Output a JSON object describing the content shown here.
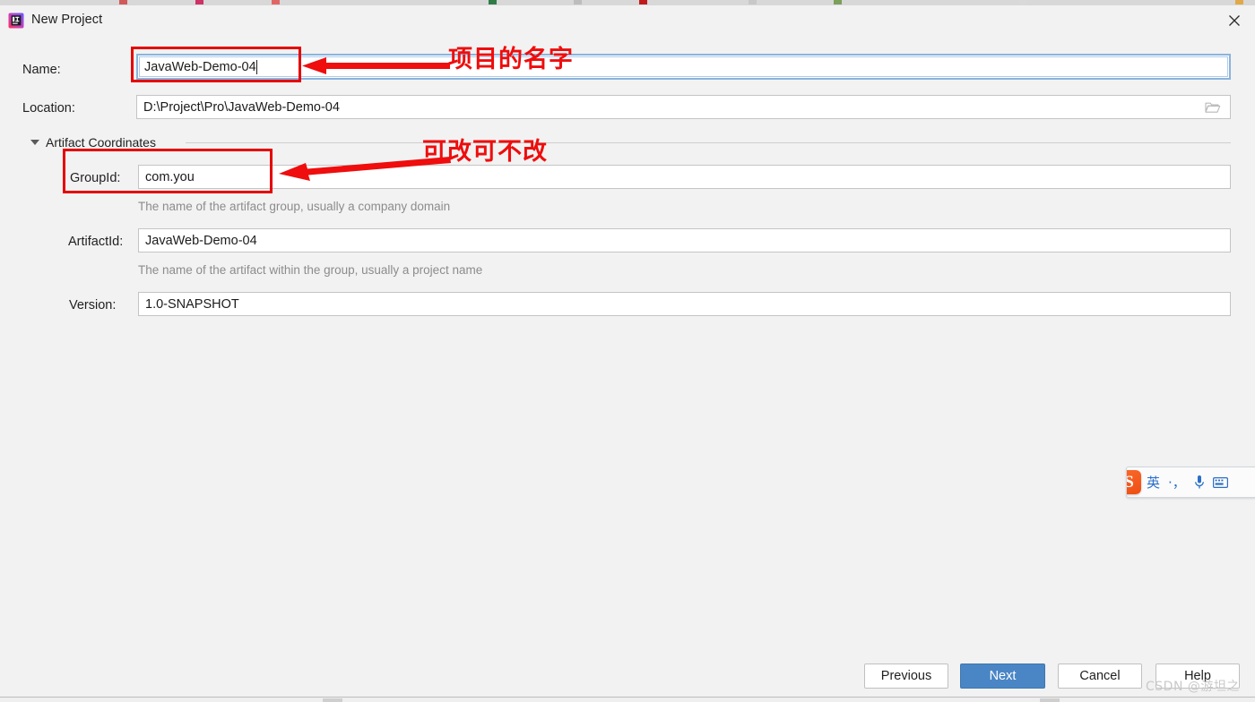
{
  "window": {
    "title": "New Project",
    "icon": "intellij-idea-icon",
    "close_label": "✕"
  },
  "form": {
    "name": {
      "label": "Name:",
      "value": "JavaWeb-Demo-04",
      "focused": true
    },
    "location": {
      "label": "Location:",
      "value": "D:\\Project\\Pro\\JavaWeb-Demo-04",
      "browse_icon": "folder-icon"
    },
    "section": {
      "title": "Artifact Coordinates",
      "expanded": true
    },
    "group_id": {
      "label": "GroupId:",
      "value": "com.you",
      "helper": "The name of the artifact group, usually a company domain"
    },
    "artifact_id": {
      "label": "ArtifactId:",
      "value": "JavaWeb-Demo-04",
      "helper": "The name of the artifact within the group, usually a project name"
    },
    "version": {
      "label": "Version:",
      "value": "1.0-SNAPSHOT"
    }
  },
  "annotations": {
    "color": "#e60000",
    "name_note": "项目的名字",
    "group_note": "可改可不改"
  },
  "buttons": {
    "previous": "Previous",
    "next": "Next",
    "cancel": "Cancel",
    "help": "Help",
    "primary_color": "#4a86c5"
  },
  "ime": {
    "logo": "sogou-logo",
    "mode": "英",
    "punctuation": "·，",
    "mic_icon": "microphone-icon",
    "keyboard_icon": "keyboard-icon"
  },
  "watermark": {
    "text": "CSDN @游坦之"
  }
}
